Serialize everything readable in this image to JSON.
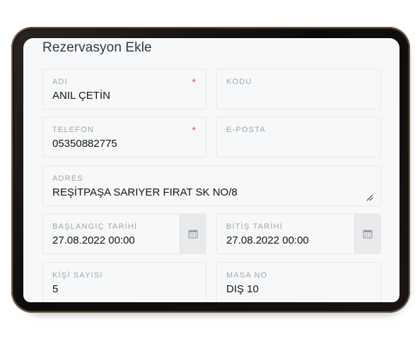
{
  "form": {
    "title": "Rezervasyon Ekle",
    "required_mark": "*",
    "fields": {
      "adi": {
        "label": "ADI",
        "value": "ANIL ÇETİN"
      },
      "kodu": {
        "label": "KODU",
        "value": ""
      },
      "telefon": {
        "label": "TELEFON",
        "value": "05350882775"
      },
      "eposta": {
        "label": "E-POSTA",
        "value": ""
      },
      "adres": {
        "label": "ADRES",
        "value": "REŞİTPAŞA SARIYER FIRAT SK NO/8"
      },
      "baslangic": {
        "label": "BAŞLANGIÇ TARİHİ",
        "value": "27.08.2022 00:00",
        "icon": "calendar-icon"
      },
      "bitis": {
        "label": "BİTİŞ TARİHİ",
        "value": "27.08.2022 00:00",
        "icon": "calendar-icon"
      },
      "kisi": {
        "label": "KİŞİ SAYISI",
        "value": "5"
      },
      "masa": {
        "label": "MASA NO",
        "value": "DIŞ 10"
      }
    }
  },
  "colors": {
    "required": "#e0454d",
    "label": "#a0a6ab",
    "value": "#151515"
  }
}
